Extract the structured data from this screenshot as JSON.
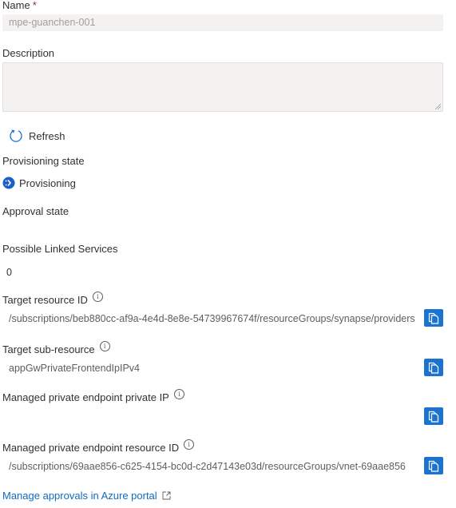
{
  "name": {
    "label": "Name",
    "required_marker": "*",
    "value": "mpe-guanchen-001"
  },
  "description": {
    "label": "Description",
    "value": ""
  },
  "refresh": {
    "label": "Refresh",
    "icon": "refresh-icon"
  },
  "provisioning_state": {
    "label": "Provisioning state",
    "value": "Provisioning",
    "icon": "provisioning-status-icon"
  },
  "approval_state": {
    "label": "Approval state",
    "value": ""
  },
  "possible_linked_services": {
    "label": "Possible Linked Services",
    "value": "0"
  },
  "target_resource_id": {
    "label": "Target resource ID",
    "value": "/subscriptions/beb880cc-af9a-4e4d-8e8e-54739967674f/resourceGroups/synapse/providers"
  },
  "target_sub_resource": {
    "label": "Target sub-resource",
    "value": "appGwPrivateFrontendIpIPv4"
  },
  "managed_pe_private_ip": {
    "label": "Managed private endpoint private IP",
    "value": ""
  },
  "managed_pe_resource_id": {
    "label": "Managed private endpoint resource ID",
    "value": "/subscriptions/69aae856-c625-4154-bc0d-c2d47143e03d/resourceGroups/vnet-69aae856"
  },
  "manage_link": {
    "label": "Manage approvals in Azure portal",
    "icon": "external-link-icon"
  },
  "colors": {
    "accent": "#1a73d1",
    "link": "#0f6cbd",
    "required": "#a4262c",
    "input_bg": "#f3f2f1"
  }
}
